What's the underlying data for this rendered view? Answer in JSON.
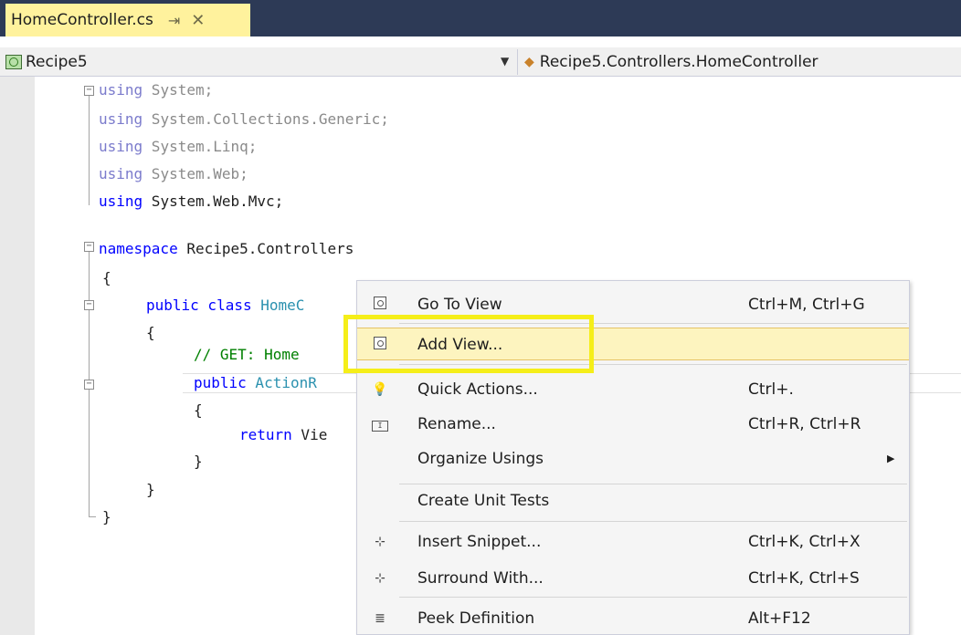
{
  "tab": {
    "title": "HomeController.cs",
    "pin_icon": "pin-icon",
    "close_icon": "close-icon"
  },
  "navbar": {
    "project": "Recipe5",
    "class_scope": "Recipe5.Controllers.HomeController"
  },
  "code": {
    "l1_kw": "using",
    "l1_rest": " System;",
    "l2_kw": "using",
    "l2_rest": " System.Collections.Generic;",
    "l3_kw": "using",
    "l3_rest": " System.Linq;",
    "l4_kw": "using",
    "l4_rest": " System.Web;",
    "l5_kw": "using",
    "l5_rest": " System.Web.Mvc;",
    "l7_kw": "namespace",
    "l7_rest": " Recipe5.Controllers",
    "l8": "{",
    "l9_kw": "public class",
    "l9_type": " HomeC",
    "l10": "{",
    "l11": "// GET: Home",
    "l12_kw": "public",
    "l12_type": " ActionR",
    "l13": "{",
    "l14_kw": "return",
    "l14_rest": " Vie",
    "l15": "}",
    "l16": "}",
    "l17": "}"
  },
  "context_menu": {
    "items": [
      {
        "label": "Go To View",
        "shortcut": "Ctrl+M, Ctrl+G",
        "icon": "go-to-view-icon"
      },
      {
        "label": "Add View...",
        "shortcut": "",
        "icon": "add-view-icon"
      },
      {
        "label": "Quick Actions...",
        "shortcut": "Ctrl+.",
        "icon": "lightbulb-icon"
      },
      {
        "label": "Rename...",
        "shortcut": "Ctrl+R, Ctrl+R",
        "icon": "rename-icon"
      },
      {
        "label": "Organize Usings",
        "shortcut": "",
        "icon": ""
      },
      {
        "label": "Create Unit Tests",
        "shortcut": "",
        "icon": ""
      },
      {
        "label": "Insert Snippet...",
        "shortcut": "Ctrl+K, Ctrl+X",
        "icon": "insert-snippet-icon"
      },
      {
        "label": "Surround With...",
        "shortcut": "Ctrl+K, Ctrl+S",
        "icon": "surround-with-icon"
      },
      {
        "label": "Peek Definition",
        "shortcut": "Alt+F12",
        "icon": "peek-definition-icon"
      }
    ],
    "highlighted": "Add View..."
  },
  "colors": {
    "tab_active": "#fff29d",
    "title_bar": "#2d3a56",
    "annotation": "#f5ee19",
    "keyword": "#0000ff",
    "type": "#2b91af",
    "comment": "#008000"
  }
}
